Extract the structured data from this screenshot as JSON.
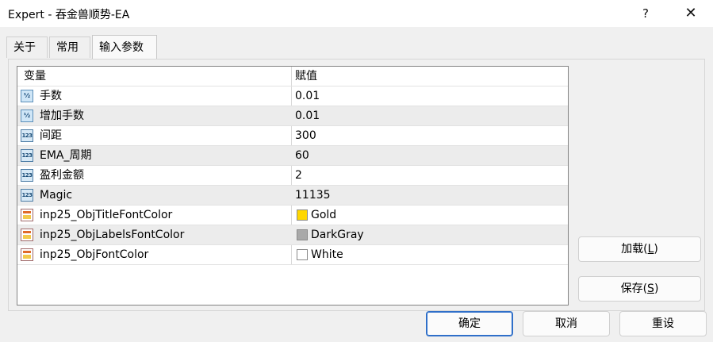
{
  "window": {
    "title": "Expert - 吞金兽顺势-EA",
    "help_glyph": "?",
    "close_glyph": "✕"
  },
  "tabs": [
    {
      "label": "关于"
    },
    {
      "label": "常用"
    },
    {
      "label": "输入参数",
      "active": true
    }
  ],
  "grid": {
    "header": {
      "name": "变量",
      "value": "赋值"
    },
    "rows": [
      {
        "icon": "fraction-icon",
        "icon_text": "½",
        "name": "手数",
        "value": "0.01"
      },
      {
        "icon": "fraction-icon",
        "icon_text": "½",
        "name": "增加手数",
        "value": "0.01"
      },
      {
        "icon": "integer-icon",
        "icon_text": "123",
        "name": "间距",
        "value": "300"
      },
      {
        "icon": "integer-icon",
        "icon_text": "123",
        "name": "EMA_周期",
        "value": "60"
      },
      {
        "icon": "integer-icon",
        "icon_text": "123",
        "name": "盈利金额",
        "value": "2"
      },
      {
        "icon": "integer-icon",
        "icon_text": "123",
        "name": "Magic",
        "value": "11135"
      },
      {
        "icon": "color-icon",
        "name": "inp25_ObjTitleFontColor",
        "value": "Gold",
        "swatch": "#FFD700"
      },
      {
        "icon": "color-icon",
        "name": "inp25_ObjLabelsFontColor",
        "value": "DarkGray",
        "swatch": "#A9A9A9"
      },
      {
        "icon": "color-icon",
        "name": "inp25_ObjFontColor",
        "value": "White",
        "swatch": "#FFFFFF"
      }
    ]
  },
  "buttons": {
    "load_main": "加载(",
    "load_key": "L",
    "load_end": ")",
    "save_main": "保存(",
    "save_key": "S",
    "save_end": ")",
    "ok": "确定",
    "cancel": "取消",
    "reset": "重设"
  }
}
